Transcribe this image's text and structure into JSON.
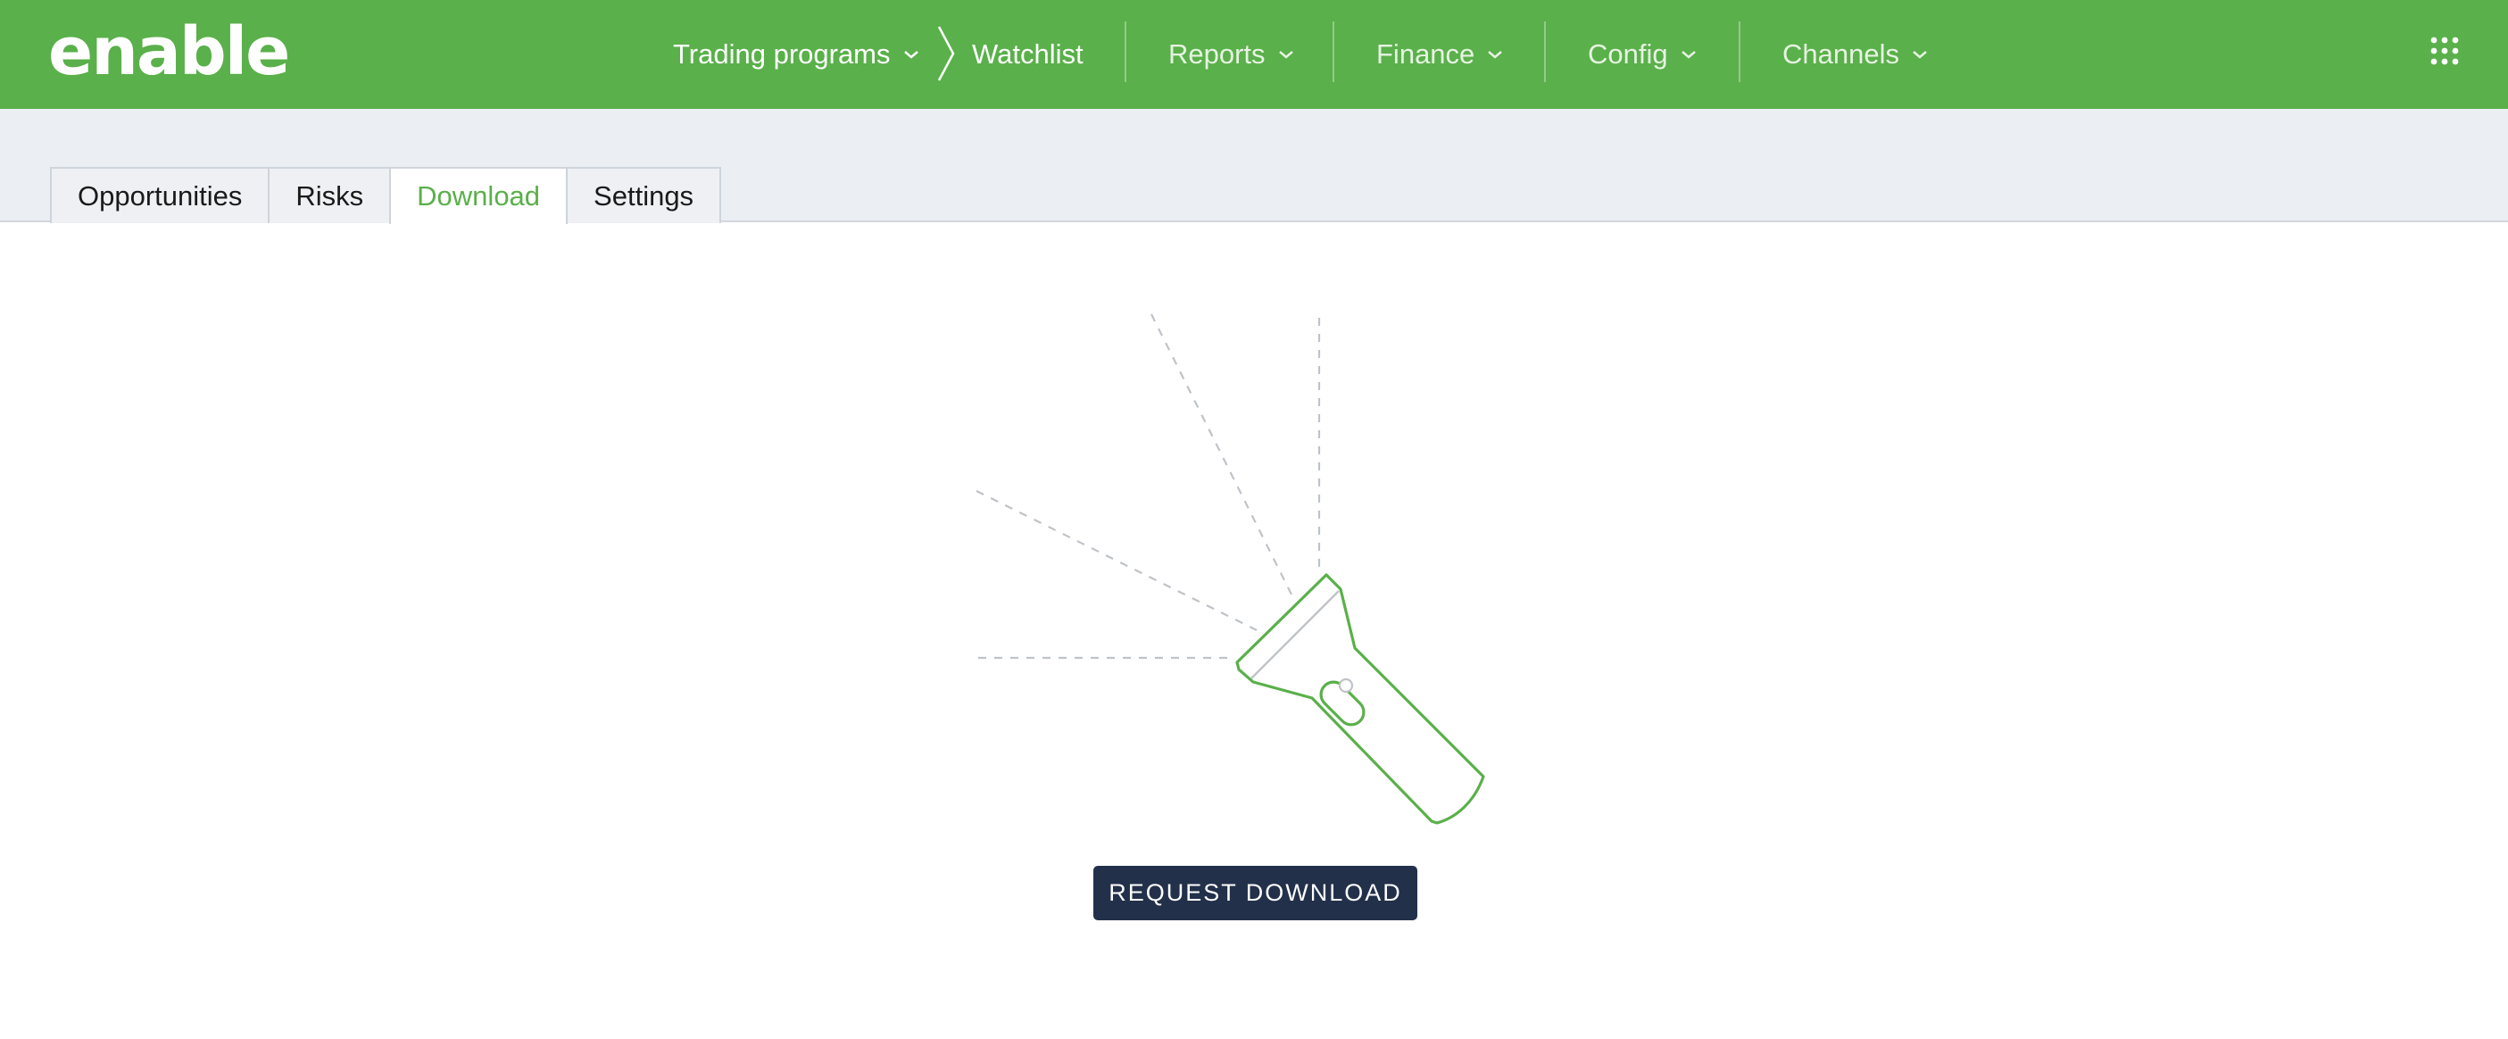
{
  "header": {
    "logo_text": "enable",
    "brand_color": "#5ab04a",
    "nav": {
      "trading_programs": "Trading programs",
      "watchlist": "Watchlist",
      "reports": "Reports",
      "finance": "Finance",
      "config": "Config",
      "channels": "Channels"
    },
    "apps_icon": "grid-icon"
  },
  "tabs": {
    "items": [
      {
        "label": "Opportunities"
      },
      {
        "label": "Risks"
      },
      {
        "label": "Download",
        "active": true
      },
      {
        "label": "Settings"
      }
    ]
  },
  "main": {
    "illustration_icon": "flashlight-icon",
    "request_button_label": "REQUEST DOWNLOAD",
    "button_color": "#22304a"
  }
}
